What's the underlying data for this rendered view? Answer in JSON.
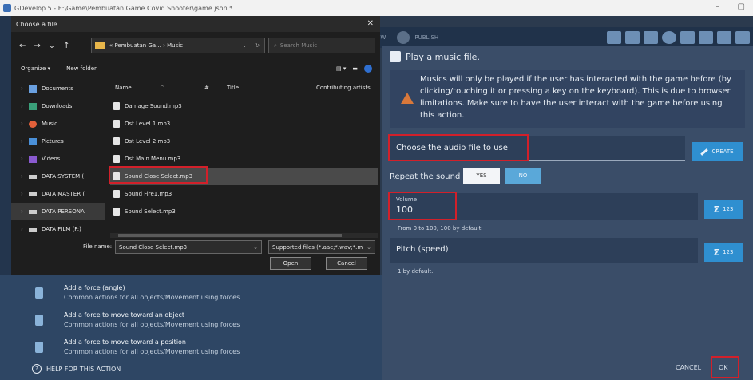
{
  "window": {
    "title": "GDevelop 5 - E:\\Game\\Pembuatan Game Covid Shooter\\game.json *"
  },
  "toolbar": {
    "view_partial": "EW",
    "publish_label": "PUBLISH"
  },
  "dialog": {
    "title": "Play a music file.",
    "warning": "Musics will only be played if the user has interacted with the game before (by clicking/touching it or pressing a key on the keyboard). This is due to browser limitations. Make sure to have the user interact with the game before using this action.",
    "audio_field_placeholder": "Choose the audio file to use",
    "create_label": "CREATE",
    "repeat_label": "Repeat the sound",
    "yes_label": "YES",
    "no_label": "NO",
    "volume_label": "Volume",
    "volume_value": "100",
    "volume_hint": "From 0 to 100, 100 by default.",
    "pitch_label": "Pitch (speed)",
    "pitch_hint": "1 by default.",
    "expr_btn_label": "123",
    "cancel_label": "CANCEL",
    "ok_label": "OK"
  },
  "behind": {
    "actions": [
      {
        "title": "Add a force (angle)",
        "sub": "Common actions for all objects/Movement using forces"
      },
      {
        "title": "Add a force to move toward an object",
        "sub": "Common actions for all objects/Movement using forces"
      },
      {
        "title": "Add a force to move toward a position",
        "sub": "Common actions for all objects/Movement using forces"
      }
    ],
    "help_label": "HELP FOR THIS ACTION"
  },
  "file_chooser": {
    "title": "Choose a file",
    "address": "« Pembuatan Ga... › Music",
    "search_placeholder": "Search Music",
    "organize_label": "Organize ▾",
    "new_folder_label": "New folder",
    "tree": [
      {
        "label": "Documents",
        "color": "#6aa0e0"
      },
      {
        "label": "Downloads",
        "color": "#3aa07a"
      },
      {
        "label": "Music",
        "color": "#e2603a"
      },
      {
        "label": "Pictures",
        "color": "#4a90d9"
      },
      {
        "label": "Videos",
        "color": "#8a5ad0"
      },
      {
        "label": "DATA SYSTEM (",
        "color": "#cccccc"
      },
      {
        "label": "DATA MASTER (",
        "color": "#cccccc"
      },
      {
        "label": "DATA PERSONA",
        "color": "#cccccc"
      },
      {
        "label": "DATA FILM (F:)",
        "color": "#cccccc"
      }
    ],
    "columns": {
      "name": "Name",
      "num": "#",
      "title": "Title",
      "artists": "Contributing artists"
    },
    "files": [
      "Damage Sound.mp3",
      "Ost Level 1.mp3",
      "Ost Level 2.mp3",
      "Ost Main Menu.mp3",
      "Sound Close Select.mp3",
      "Sound Fire1.mp3",
      "Sound Select.mp3"
    ],
    "file_name_label": "File name:",
    "file_name_value": "Sound Close Select.mp3",
    "file_type": "Supported files (*.aac;*.wav;*.m",
    "open_label": "Open",
    "cancel_label": "Cancel"
  }
}
